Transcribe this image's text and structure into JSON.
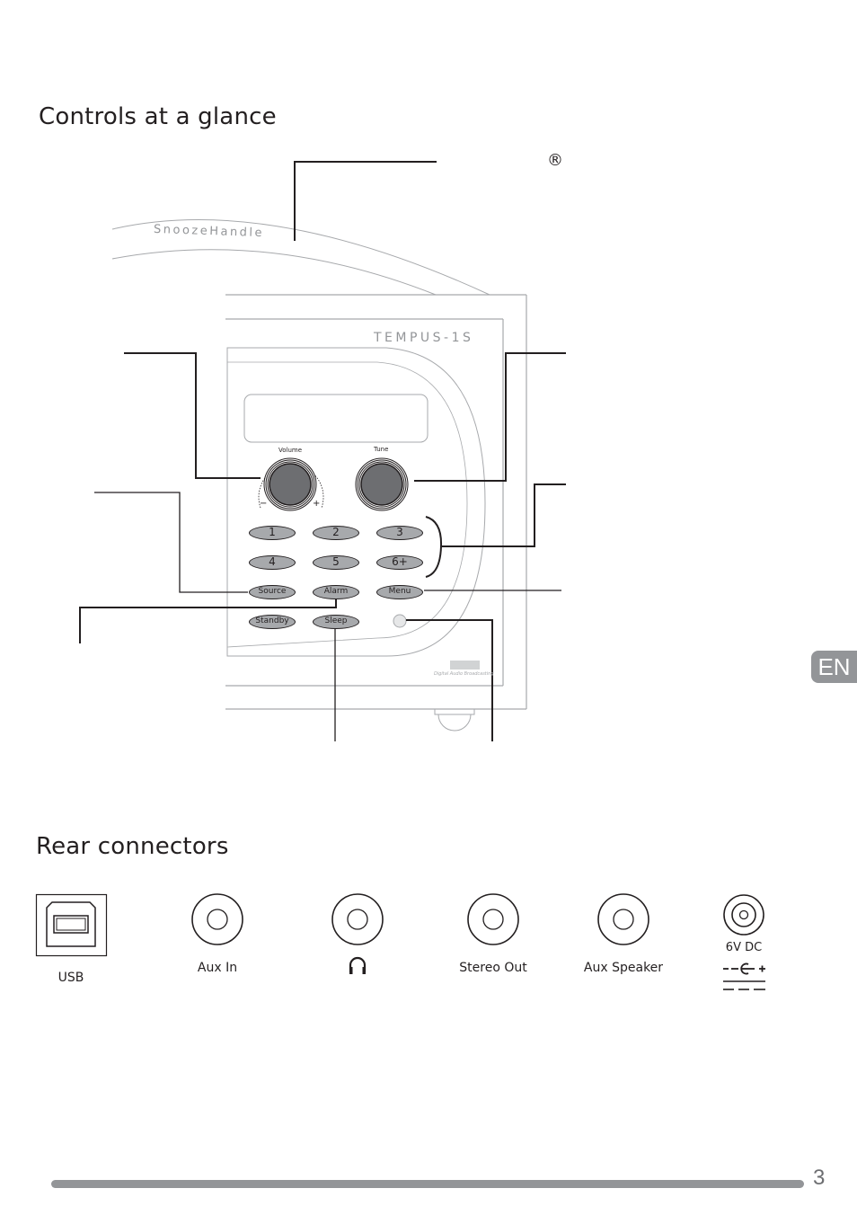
{
  "sections": {
    "controls_title": "Controls at a glance",
    "rear_title": "Rear connectors"
  },
  "device": {
    "model": "TEMPUS-1S",
    "handle_label": "SnoozeHandle",
    "registered_mark": "®",
    "knobs": [
      {
        "name": "volume",
        "label": "Volume",
        "minus": "−",
        "plus": "+"
      },
      {
        "name": "tune",
        "label": "Tune"
      }
    ],
    "preset_buttons": [
      "1",
      "2",
      "3",
      "4",
      "5",
      "6+"
    ],
    "function_buttons": [
      "Source",
      "Alarm",
      "Menu",
      "Standby",
      "Sleep"
    ],
    "dab_logo": "DAB",
    "dab_tagline": "Digital Audio Broadcasting"
  },
  "connectors": [
    {
      "name": "usb",
      "label": "USB"
    },
    {
      "name": "aux-in",
      "label": "Aux In"
    },
    {
      "name": "headphones",
      "label": "headphones-icon"
    },
    {
      "name": "stereo-out",
      "label": "Stereo Out"
    },
    {
      "name": "aux-speaker",
      "label": "Aux Speaker"
    },
    {
      "name": "dc-in",
      "label": "6V DC"
    }
  ],
  "language_tab": "EN",
  "page_number": "3",
  "colors": {
    "text": "#231f20",
    "button_fill": "#a7a9ac",
    "knob_fill": "#6d6e71",
    "outline_gray": "#a7a9ac",
    "tab_gray": "#939598"
  }
}
